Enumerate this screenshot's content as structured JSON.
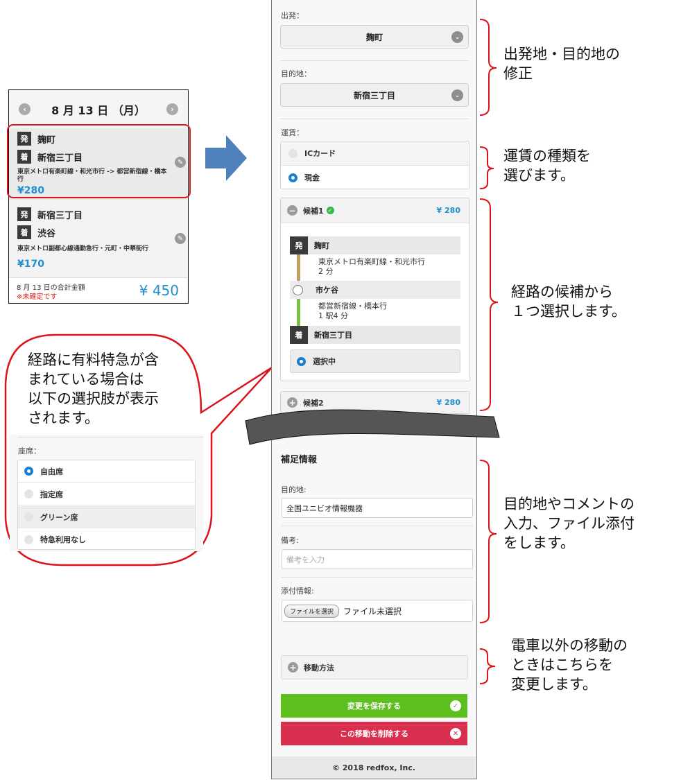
{
  "left_card": {
    "prev_icon": "chevron-left-icon",
    "next_icon": "chevron-right-icon",
    "date": "8 月 13 日 （月）",
    "trips": [
      {
        "from_badge": "発",
        "from": "麹町",
        "to_badge": "着",
        "to": "新宿三丁目",
        "line": "東京メトロ有楽町線・和光市行 -> 都営新宿線・橋本行",
        "price": "¥280",
        "edit_icon": "pencil-icon",
        "highlighted": true
      },
      {
        "from_badge": "発",
        "from": "新宿三丁目",
        "to_badge": "着",
        "to": "渋谷",
        "line": "東京メトロ副都心線通勤急行・元町・中華街行",
        "price": "¥170",
        "edit_icon": "pencil-icon",
        "highlighted": false
      }
    ],
    "total_label": "8 月 13 日の合計金額",
    "unconfirmed": "※未確定です",
    "total": "¥ 450"
  },
  "arrow_icon": "arrow-right-icon",
  "phone": {
    "departure_label": "出発：",
    "departure_value": "麹町",
    "destination_label": "目的地：",
    "destination_value": "新宿三丁目",
    "fare_label": "運賃：",
    "fare_options": [
      {
        "label": "ICカード",
        "selected": false
      },
      {
        "label": "現金",
        "selected": true
      }
    ],
    "candidate1": {
      "title": "候補1",
      "price": "¥ 280",
      "steps": [
        {
          "badge": "発",
          "station": "麹町"
        },
        {
          "line": "東京メトロ有楽町線・和光市行",
          "duration": "2 分"
        },
        {
          "station": "市ケ谷"
        },
        {
          "line": "都営新宿線・橋本行",
          "duration": "1 駅4 分"
        },
        {
          "badge": "着",
          "station": "新宿三丁目"
        }
      ],
      "select_label": "選択中"
    },
    "candidate2": {
      "title": "候補2",
      "price": "¥ 280"
    },
    "supplement_title": "補足情報",
    "dest_field_label": "目的地:",
    "dest_field_value": "全国ユニビオ情報機器",
    "remarks_label": "備考:",
    "remarks_placeholder": "備考を入力",
    "attachment_label": "添付情報:",
    "file_button": "ファイルを選択",
    "file_status": "ファイル未選択",
    "transport_label": "移動方法",
    "save_button": "変更を保存する",
    "delete_button": "この移動を削除する",
    "footer": "© 2018 redfox, Inc.",
    "colors": {
      "save": "#5cbf1e",
      "delete": "#d9304f",
      "accent": "#1e8fd0",
      "line1": "#c0a060",
      "line2": "#7bc043"
    }
  },
  "bubble": {
    "text": [
      "経路に有料特急が含",
      "まれている場合は",
      "以下の選択肢が表示",
      "されます。"
    ],
    "seat_label": "座席：",
    "seat_options": [
      {
        "label": "自由席",
        "selected": true
      },
      {
        "label": "指定席",
        "selected": false
      },
      {
        "label": "グリーン席",
        "selected": false
      },
      {
        "label": "特急利用なし",
        "selected": false
      }
    ]
  },
  "annotations": {
    "a1": [
      "出発地・目的地の",
      "修正"
    ],
    "a2": [
      "運賃の種類を",
      "選びます。"
    ],
    "a3": [
      "経路の候補から",
      "１つ選択します。"
    ],
    "a4": [
      "目的地やコメントの",
      "入力、ファイル添付",
      "をします。"
    ],
    "a5": [
      "電車以外の移動の",
      "ときはこちらを",
      "変更します。"
    ]
  }
}
